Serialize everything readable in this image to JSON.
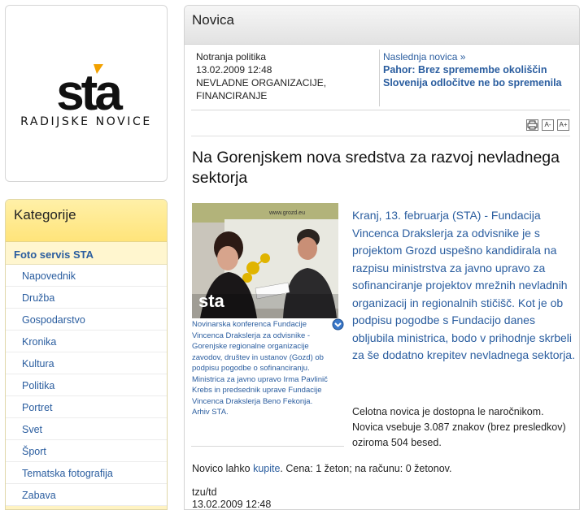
{
  "logo": {
    "brand": "sta",
    "subtitle": "RADIJSKE NOVICE"
  },
  "categories": {
    "title": "Kategorije",
    "featured": "Foto servis STA",
    "items": [
      "Napovednik",
      "Družba",
      "Gospodarstvo",
      "Kronika",
      "Kultura",
      "Politika",
      "Portret",
      "Svet",
      "Šport",
      "Tematska fotografija",
      "Zabava"
    ]
  },
  "article": {
    "panel_title": "Novica",
    "meta": {
      "section": "Notranja politika",
      "datetime": "13.02.2009 12:48",
      "tags": "NEVLADNE ORGANIZACIJE, FINANCIRANJE"
    },
    "next": {
      "label": "Naslednja novica »",
      "title": "Pahor: Brez spremembe okoliščin Slovenija odločitve ne bo spremenila"
    },
    "tools": {
      "print": "print-icon",
      "font_smaller": "A-",
      "font_larger": "A+"
    },
    "headline": "Na Gorenjskem nova sredstva za razvoj nevladnega sektorja",
    "photo": {
      "caption": "Novinarska konferenca Fundacije Vincenca Drakslerja za odvisnike - Gorenjske regionalne organizacije zavodov, društev in ustanov (Gozd) ob podpisu pogodbe o sofinanciranju. Ministrica za javno upravo Irma Pavlinič Krebs in predsednik uprave Fundacije Vincenca Drakslerja Beno Fekonja.",
      "credit": "Arhiv STA.",
      "watermark": "sta",
      "banner_text": "www.grozd.eu"
    },
    "lead": "Kranj, 13. februarja (STA) - Fundacija Vincenca Drakslerja za odvisnike je s projektom Grozd uspešno kandidirala na razpisu ministrstva za javno upravo za sofinanciranje projektov mrežnih nevladnih organizacij in regionalnih stičišč. Kot je ob podpisu pogodbe s Fundacijo danes obljubila ministrica, bodo v prihodnje skrbeli za še dodatno krepitev nevladnega sektorja.",
    "notice": "Celotna novica je dostopna le naročnikom. Novica vsebuje 3.087 znakov (brez presledkov) oziroma 504 besed.",
    "purchase": {
      "prefix": "Novico lahko",
      "link": "kupite",
      "suffix": ". Cena: 1 žeton; na računu: 0 žetonov."
    },
    "signature": {
      "author": "tzu/td",
      "datetime": "13.02.2009 12:48"
    }
  },
  "colors": {
    "link": "#2a5d9f",
    "category_header": "#ffe47a",
    "panel_header": "#e2e2e2"
  }
}
